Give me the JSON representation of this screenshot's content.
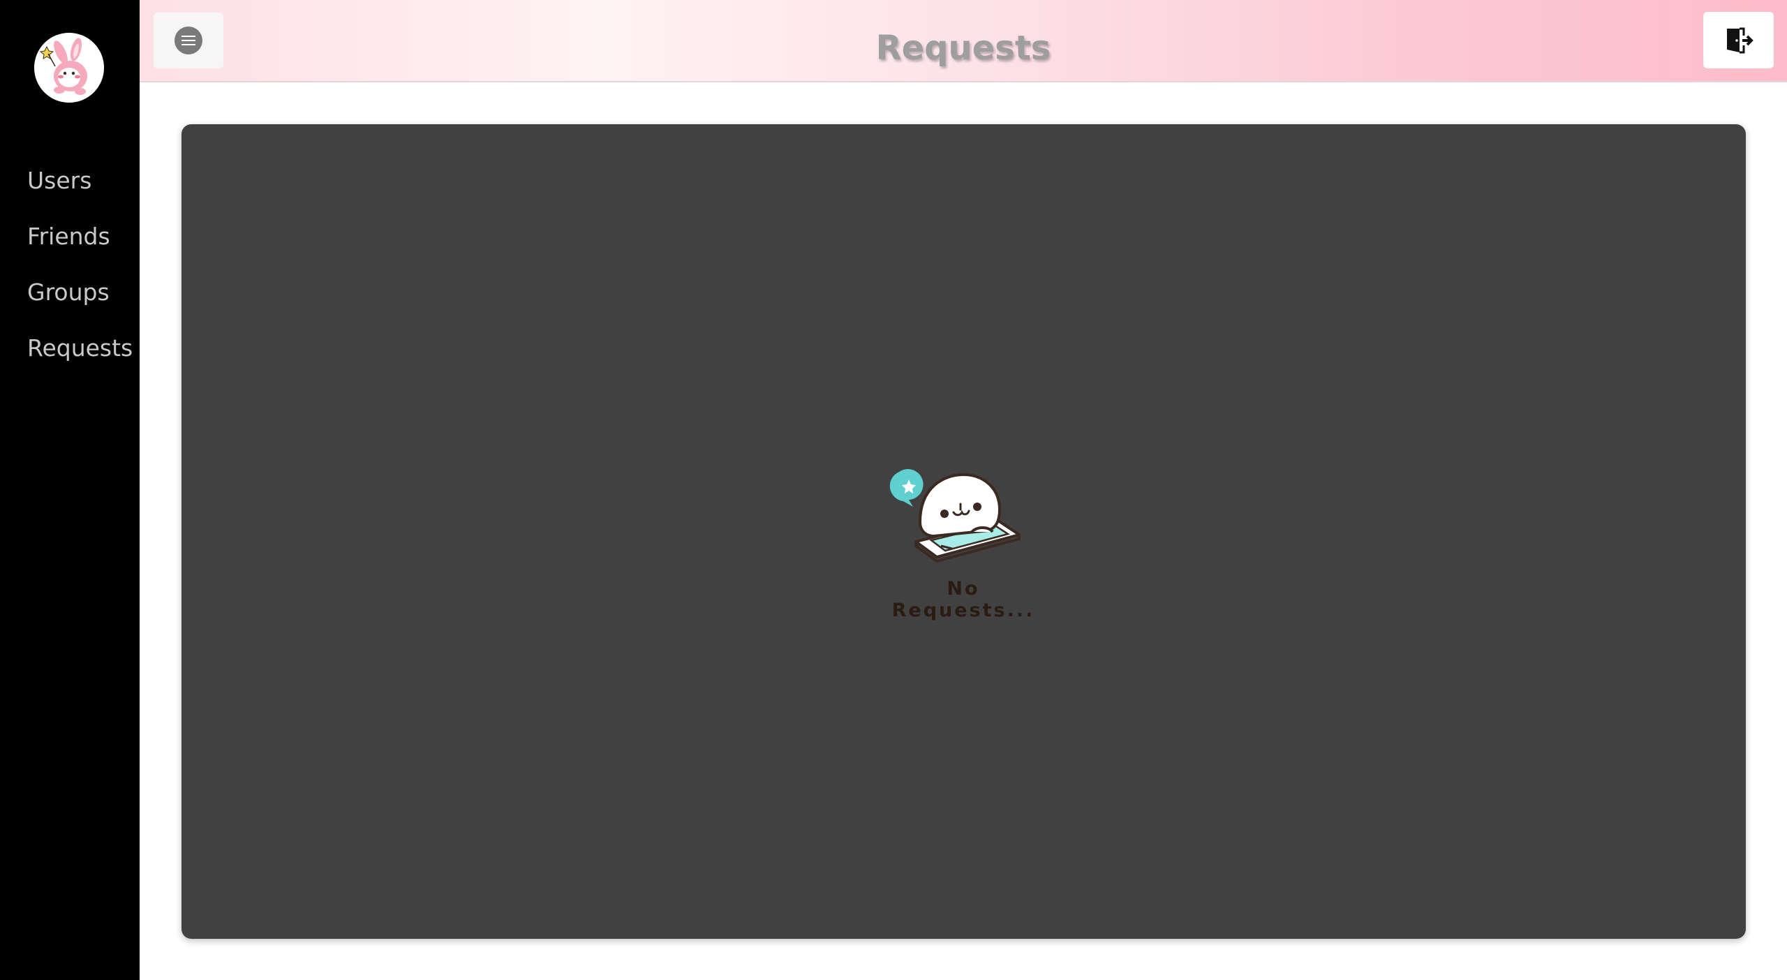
{
  "sidebar": {
    "avatar_alt": "avatar",
    "items": [
      {
        "label": "Users"
      },
      {
        "label": "Friends"
      },
      {
        "label": "Groups"
      },
      {
        "label": "Requests"
      }
    ]
  },
  "header": {
    "title": "Requests",
    "menu_icon": "hamburger-icon",
    "logout_icon": "logout-door-icon"
  },
  "main": {
    "empty_message": "No Requests...",
    "empty_icon": "seal-on-phone-illustration"
  },
  "colors": {
    "sidebar_bg": "#000000",
    "panel_bg": "#414141",
    "title_color": "#9e9e9e",
    "nav_text": "#c9c9c9",
    "header_pink": "#fdbcc9",
    "accent_teal": "#5fd0cf"
  }
}
